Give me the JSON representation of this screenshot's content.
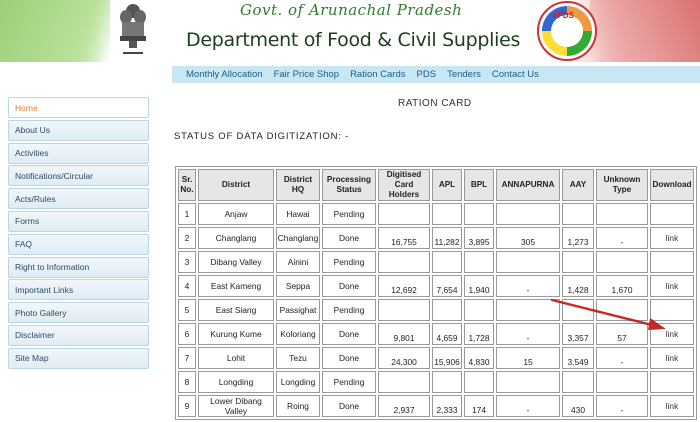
{
  "header": {
    "govt_title": "Govt. of Arunachal Pradesh",
    "dept_title": "Department of Food & Civil Supplies",
    "logo_text": "ePDS",
    "emblem": "state-emblem-icon"
  },
  "topnav": [
    "Monthly Allocation",
    "Fair Price Shop",
    "Ration Cards",
    "PDS",
    "Tenders",
    "Contact Us"
  ],
  "sidebar": {
    "items": [
      "Home",
      "About Us",
      "Activities",
      "Notifications/Circular",
      "Acts/Rules",
      "Forms",
      "FAQ",
      "Right to Information",
      "Important Links",
      "Photo Gallery",
      "Disclaimer",
      "Site Map"
    ],
    "active_index": 0
  },
  "content": {
    "heading": "RATION CARD",
    "status_heading": "STATUS OF DATA DIGITIZATION: -"
  },
  "table": {
    "headers": [
      "Sr. No.",
      "District",
      "District HQ",
      "Processing Status",
      "Digitised Card Holders",
      "APL",
      "BPL",
      "ANNAPURNA",
      "AAY",
      "Unknown Type",
      "Download"
    ],
    "rows": [
      [
        "1",
        "Anjaw",
        "Hawai",
        "Pending",
        "",
        "",
        "",
        "",
        "",
        "",
        ""
      ],
      [
        "2",
        "Changlang",
        "Changlang",
        "Done",
        "16,755",
        "11,282",
        "3,895",
        "305",
        "1,273",
        "-",
        "link"
      ],
      [
        "3",
        "Dibang Valley",
        "Ainini",
        "Pending",
        "",
        "",
        "",
        "",
        "",
        "",
        ""
      ],
      [
        "4",
        "East Kameng",
        "Seppa",
        "Done",
        "12,692",
        "7,654",
        "1,940",
        "-",
        "1,428",
        "1,670",
        "link"
      ],
      [
        "5",
        "East Siang",
        "Passighat",
        "Pending",
        "",
        "",
        "",
        "",
        "",
        "",
        ""
      ],
      [
        "6",
        "Kurung Kume",
        "Koloriang",
        "Done",
        "9,801",
        "4,659",
        "1,728",
        "-",
        "3,357",
        "57",
        "link"
      ],
      [
        "7",
        "Lohit",
        "Tezu",
        "Done",
        "24,300",
        "15,906",
        "4,830",
        "15",
        "3,549",
        "-",
        "link"
      ],
      [
        "8",
        "Longding",
        "Longding",
        "Pending",
        "",
        "",
        "",
        "",
        "",
        "",
        ""
      ],
      [
        "9",
        "Lower Dibang Valley",
        "Roing",
        "Done",
        "2,937",
        "2,333",
        "174",
        "-",
        "430",
        "-",
        "link"
      ]
    ]
  },
  "colors": {
    "nav_bg": "#c9e7f2",
    "active_sidebar": "#e07b1a",
    "arrow": "#c62828"
  }
}
